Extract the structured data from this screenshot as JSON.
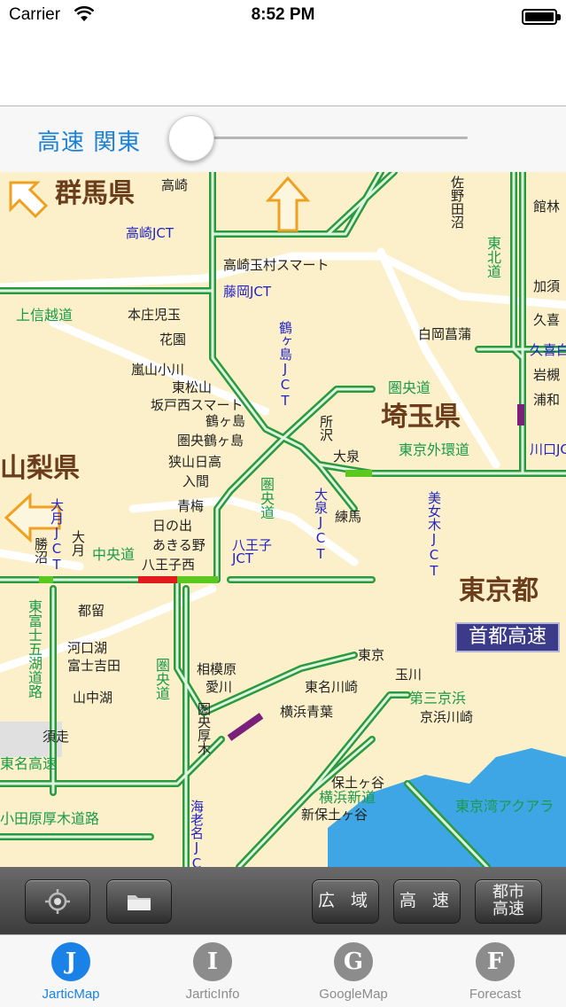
{
  "status_bar": {
    "carrier": "Carrier",
    "time": "8:52 PM"
  },
  "slider": {
    "label": "高速 関東",
    "value": 0.05
  },
  "map": {
    "prefectures": [
      {
        "id": "gunma",
        "text": "群馬県"
      },
      {
        "id": "saitama",
        "text": "埼玉県"
      },
      {
        "id": "yamanashi",
        "text": "山梨県"
      },
      {
        "id": "tokyo",
        "text": "東京都"
      }
    ],
    "shuto_label": "首都高速",
    "jcts": [
      {
        "id": "takasaki",
        "text": "高崎JCT"
      },
      {
        "id": "fujioka",
        "text": "藤岡JCT"
      },
      {
        "id": "tsurugashima",
        "text": "鶴ヶ島JCT"
      },
      {
        "id": "oizumi",
        "text": "大泉JCT"
      },
      {
        "id": "otsuki",
        "text": "大月JCT"
      },
      {
        "id": "hachioji",
        "text": "八王子JCT"
      },
      {
        "id": "bijogi",
        "text": "美女木JCT"
      },
      {
        "id": "ebina",
        "text": "海老名JCT"
      },
      {
        "id": "shirakobato",
        "text": "久喜白"
      },
      {
        "id": "kawaguchi",
        "text": "川口JC"
      }
    ],
    "roads": [
      {
        "id": "joshinetsu",
        "text": "上信越道"
      },
      {
        "id": "tohoku",
        "text": "東北道"
      },
      {
        "id": "kenodo1",
        "text": "圏央道"
      },
      {
        "id": "kenodo2",
        "text": "圏央道"
      },
      {
        "id": "kenodo3",
        "text": "圏央道"
      },
      {
        "id": "gaikan",
        "text": "東京外環道"
      },
      {
        "id": "chuo",
        "text": "中央道"
      },
      {
        "id": "fujigoko",
        "text": "東富士五湖道路"
      },
      {
        "id": "tomei",
        "text": "東名高速"
      },
      {
        "id": "odawara",
        "text": "小田原厚木道路"
      },
      {
        "id": "daisan",
        "text": "第三京浜"
      },
      {
        "id": "yokohama_shindo",
        "text": "横浜新道"
      },
      {
        "id": "aqua",
        "text": "東京湾アクアラ"
      }
    ],
    "cities": [
      {
        "id": "takasaki_c",
        "text": "高崎"
      },
      {
        "id": "tamamura",
        "text": "高崎玉村スマート"
      },
      {
        "id": "honjo",
        "text": "本庄児玉"
      },
      {
        "id": "hanazono",
        "text": "花園"
      },
      {
        "id": "ranzan",
        "text": "嵐山小川"
      },
      {
        "id": "higashimatsuyama",
        "text": "東松山"
      },
      {
        "id": "sakado",
        "text": "坂戸西スマート"
      },
      {
        "id": "tsurugashima_c",
        "text": "鶴ヶ島"
      },
      {
        "id": "kenotsuru",
        "text": "圏央鶴ヶ島"
      },
      {
        "id": "sayama",
        "text": "狭山日高"
      },
      {
        "id": "iruma",
        "text": "入間"
      },
      {
        "id": "ome",
        "text": "青梅"
      },
      {
        "id": "hinode",
        "text": "日の出"
      },
      {
        "id": "akiruno",
        "text": "あきる野"
      },
      {
        "id": "hachiojinishi",
        "text": "八王子西"
      },
      {
        "id": "shiraokashobu",
        "text": "白岡菖蒲"
      },
      {
        "id": "tokorozawa",
        "text": "所沢"
      },
      {
        "id": "oizumi_c",
        "text": "大泉"
      },
      {
        "id": "nerima",
        "text": "練馬"
      },
      {
        "id": "tokyo_c",
        "text": "東京"
      },
      {
        "id": "tamagawa",
        "text": "玉川"
      },
      {
        "id": "tomeikawasaki",
        "text": "東名川崎"
      },
      {
        "id": "yokohamaaoba",
        "text": "横浜青葉"
      },
      {
        "id": "keihinkawasaki",
        "text": "京浜川崎"
      },
      {
        "id": "hodogaya",
        "text": "保土ヶ谷"
      },
      {
        "id": "shinhodogaya",
        "text": "新保土ヶ谷"
      },
      {
        "id": "sagamihara",
        "text": "相模原"
      },
      {
        "id": "aikawa",
        "text": "愛川"
      },
      {
        "id": "kenatsugi",
        "text": "圏央厚木"
      },
      {
        "id": "kawaguchiko",
        "text": "河口湖"
      },
      {
        "id": "fujiyoshida",
        "text": "富士吉田"
      },
      {
        "id": "yamanakako",
        "text": "山中湖"
      },
      {
        "id": "tsuru",
        "text": "都留"
      },
      {
        "id": "katsunuma",
        "text": "勝沼"
      },
      {
        "id": "otsuki_c",
        "text": "大月"
      },
      {
        "id": "sushiri",
        "text": "須走"
      },
      {
        "id": "tamba",
        "text": "館林"
      },
      {
        "id": "sano",
        "text": "佐野田沼"
      },
      {
        "id": "kazo",
        "text": "加須"
      },
      {
        "id": "kuki",
        "text": "久喜"
      },
      {
        "id": "iwatsuki",
        "text": "岩槻"
      },
      {
        "id": "urawa",
        "text": "浦和"
      }
    ]
  },
  "toolbar": {
    "wide_label": "広 域",
    "highway_label": "高 速",
    "urban_label_1": "都市",
    "urban_label_2": "高速"
  },
  "tabs": [
    {
      "label": "JarticMap",
      "letter": "J",
      "color": "#1a82e6",
      "label_color": "#1a82e6"
    },
    {
      "label": "JarticInfo",
      "letter": "I",
      "color": "#8c8c8c",
      "label_color": "#8c8c8c"
    },
    {
      "label": "GoogleMap",
      "letter": "G",
      "color": "#8c8c8c",
      "label_color": "#8c8c8c"
    },
    {
      "label": "Forecast",
      "letter": "F",
      "color": "#8c8c8c",
      "label_color": "#8c8c8c"
    }
  ]
}
